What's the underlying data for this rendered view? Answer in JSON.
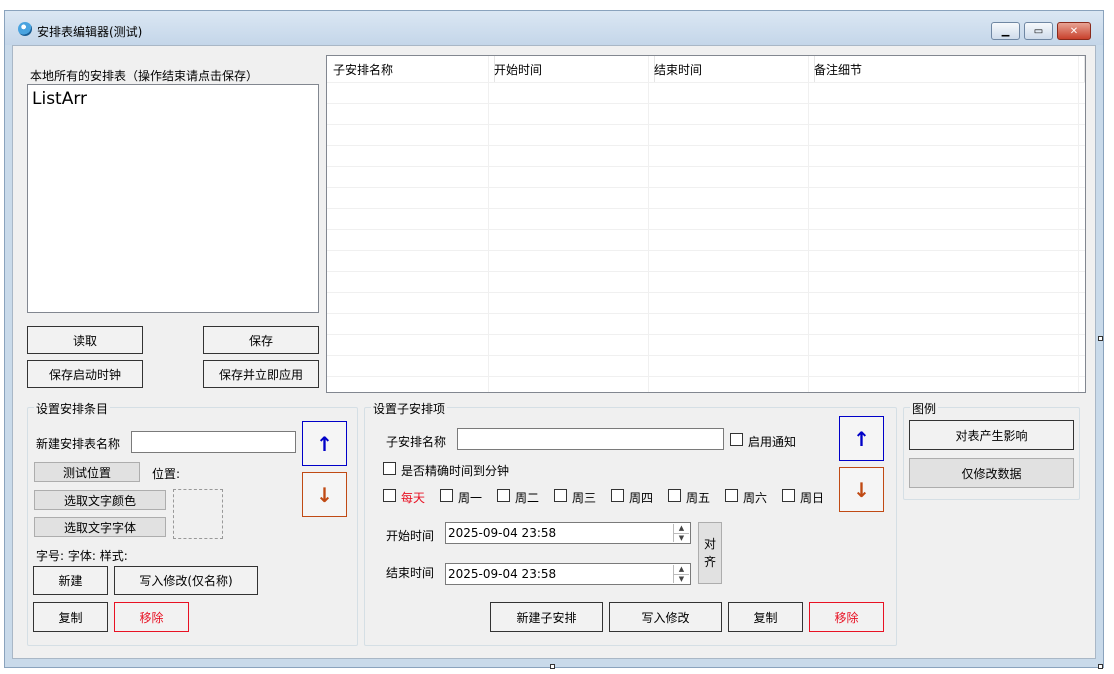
{
  "window": {
    "title": "安排表编辑器(测试)",
    "caption_buttons": {
      "minimize_icon": "minimize-icon",
      "maximize_icon": "maximize-icon",
      "close_icon": "close-icon"
    }
  },
  "local": {
    "label": "本地所有的安排表（操作结束请点击保存）",
    "list_items": [
      "ListArr"
    ],
    "read_button": "读取",
    "save_button": "保存",
    "save_startup_clock_button": "保存启动时钟",
    "save_apply_button": "保存并立即应用"
  },
  "grid": {
    "columns": [
      "子安排名称",
      "开始时间",
      "结束时间",
      "备注细节"
    ]
  },
  "entry_group": {
    "title": "设置安排条目",
    "new_name_label": "新建安排表名称",
    "new_name_value": "",
    "test_position_button": "测试位置",
    "position_label": "位置:",
    "pick_color_button": "选取文字颜色",
    "pick_font_button": "选取文字字体",
    "font_info_label": "字号: 字体: 样式:",
    "new_button": "新建",
    "write_name_button": "写入修改(仅名称)",
    "copy_button": "复制",
    "remove_button": "移除",
    "up_arrow": "↑",
    "down_arrow": "↓"
  },
  "sub_group": {
    "title": "设置子安排项",
    "name_label": "子安排名称",
    "name_value": "",
    "enable_notify_label": "启用通知",
    "precise_label": "是否精确时间到分钟",
    "days": [
      "每天",
      "周一",
      "周二",
      "周三",
      "周四",
      "周五",
      "周六",
      "周日"
    ],
    "start_label": "开始时间",
    "start_value": "2025-09-04 23:58",
    "end_label": "结束时间",
    "end_value": "2025-09-04 23:58",
    "align_button": "对齐",
    "new_sub_button": "新建子安排",
    "write_button": "写入修改",
    "copy_button": "复制",
    "remove_button": "移除",
    "up_arrow": "↑",
    "down_arrow": "↓"
  },
  "legend_group": {
    "title": "图例",
    "affects_table_button": "对表产生影响",
    "data_only_button": "仅修改数据"
  },
  "colors": {
    "accent_blue": "#0000c8",
    "accent_orange": "#c04a14",
    "danger_red": "#e81123"
  }
}
